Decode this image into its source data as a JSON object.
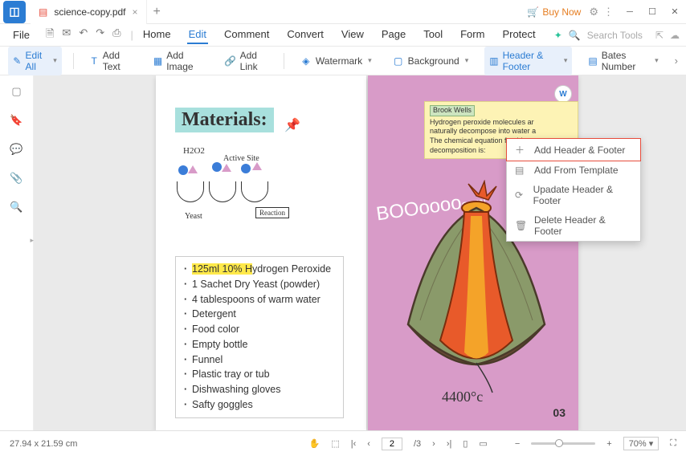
{
  "titlebar": {
    "doc_name": "science-copy.pdf",
    "buy_now": "Buy Now"
  },
  "menu": {
    "file": "File",
    "tabs": [
      "Home",
      "Edit",
      "Comment",
      "Convert",
      "View",
      "Page",
      "Tool",
      "Form",
      "Protect"
    ],
    "active_index": 1,
    "search_placeholder": "Search Tools"
  },
  "toolbar": {
    "edit_all": "Edit All",
    "add_text": "Add Text",
    "add_image": "Add Image",
    "add_link": "Add Link",
    "watermark": "Watermark",
    "background": "Background",
    "header_footer": "Header & Footer",
    "bates": "Bates Number"
  },
  "dropdown": {
    "add": "Add Header & Footer",
    "template": "Add From Template",
    "update": "Upadate Header & Footer",
    "delete": "Delete Header & Footer"
  },
  "left_page": {
    "title": "Materials:",
    "h2o2": "H2O2",
    "active": "Active Site",
    "yeast": "Yeast",
    "reaction": "Reaction",
    "items": [
      "125ml 10% Hydrogen Peroxide",
      "1 Sachet Dry Yeast (powder)",
      "4 tablespoons of warm water",
      "Detergent",
      "Food color",
      "Empty bottle",
      "Funnel",
      "Plastic tray or tub",
      "Dishwashing gloves",
      "Safty goggles"
    ],
    "highlight_chars": 15
  },
  "right_page": {
    "author": "Brook Wells",
    "note_l1": "Hydrogen peroxide molecules ar",
    "note_l2": "naturally decompose into water a",
    "note_l3": "The chemical equation for this decomposition is:",
    "boom": "BOOoooo",
    "temp": "4400°c",
    "page_num": "03"
  },
  "status": {
    "dims": "27.94 x 21.59 cm",
    "page_current": "2",
    "page_total": "/3",
    "zoom": "70%"
  }
}
